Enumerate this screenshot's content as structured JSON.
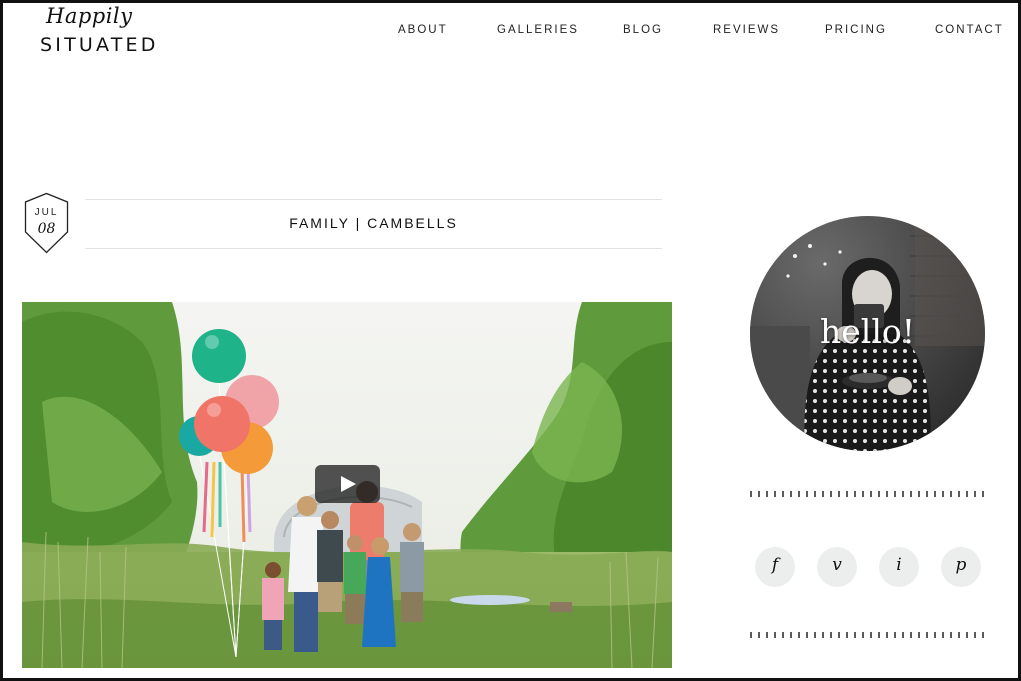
{
  "site": {
    "logo_script": "Happily",
    "logo_main": "SITUATED"
  },
  "nav": {
    "items": [
      {
        "label": "ABOUT"
      },
      {
        "label": "GALLERIES"
      },
      {
        "label": "BLOG"
      },
      {
        "label": "REVIEWS"
      },
      {
        "label": "PRICING"
      },
      {
        "label": "CONTACT"
      }
    ]
  },
  "post": {
    "date_month": "JUL",
    "date_day": "08",
    "title": "FAMILY | CAMBELLS"
  },
  "sidebar": {
    "hello_text": "hello!",
    "social": [
      {
        "glyph": "f",
        "icon": "facebook-icon"
      },
      {
        "glyph": "v",
        "icon": "vimeo-icon"
      },
      {
        "glyph": "i",
        "icon": "instagram-icon"
      },
      {
        "glyph": "p",
        "icon": "pinterest-icon"
      }
    ]
  },
  "colors": {
    "text": "#222222",
    "rule": "#e2e2e2",
    "social_bg": "#eceeee",
    "foliage": "#5f9a3c",
    "balloon_teal": "#1fb38a",
    "balloon_coral": "#f07468",
    "balloon_orange": "#f59a38",
    "balloon_pink": "#f0a4a8"
  }
}
